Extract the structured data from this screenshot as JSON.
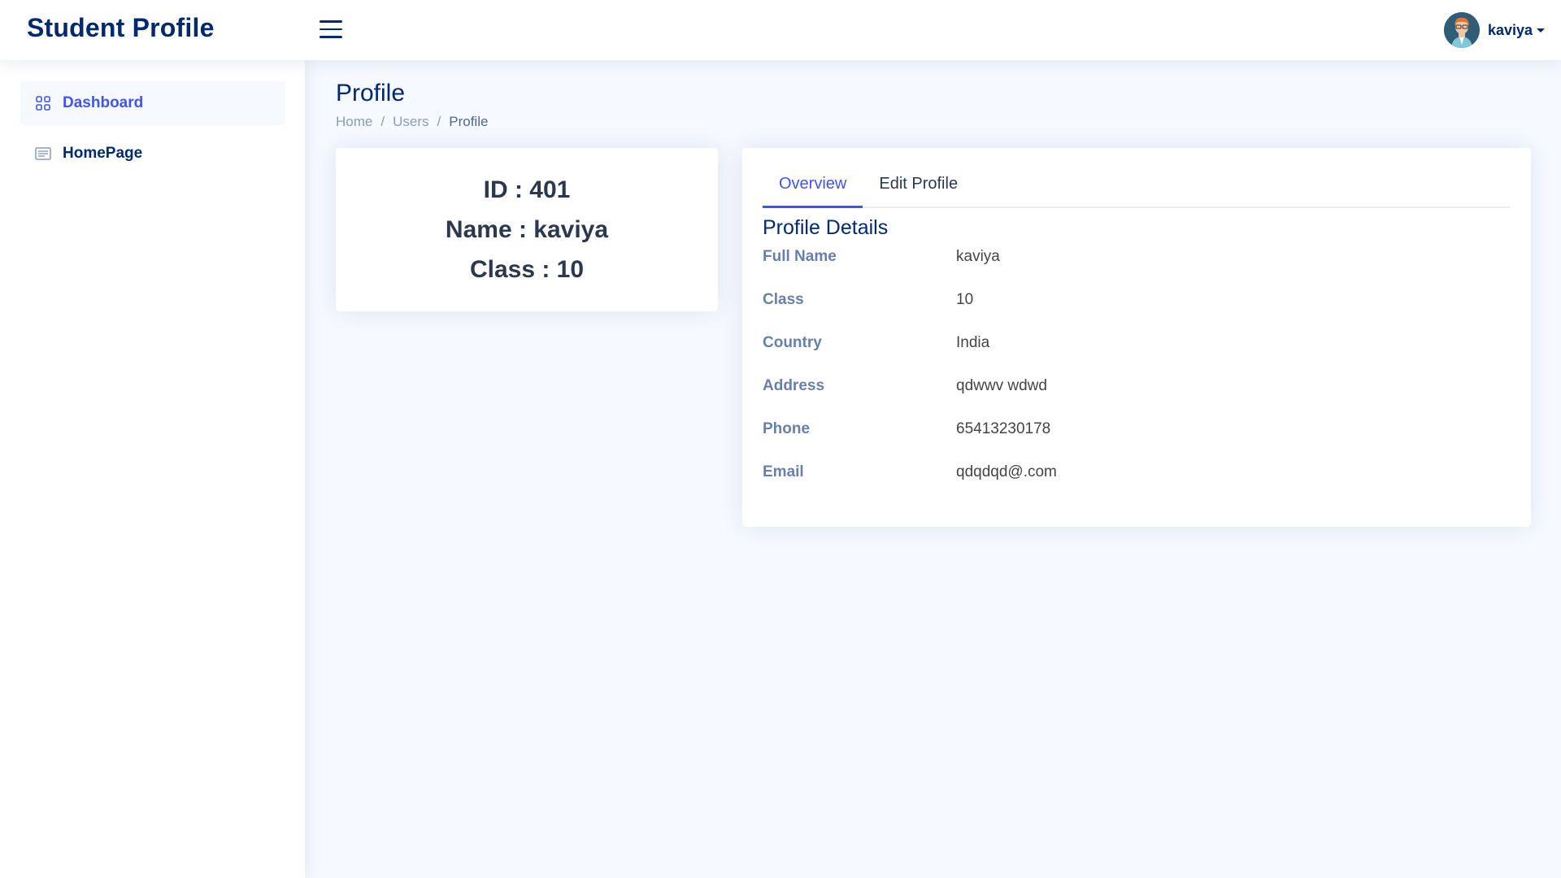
{
  "header": {
    "logo": "Student Profile",
    "user_name": "kaviya"
  },
  "sidebar": {
    "items": [
      {
        "label": "Dashboard",
        "icon": "grid-icon"
      },
      {
        "label": "HomePage",
        "icon": "layout-text-icon"
      }
    ]
  },
  "pagetitle": {
    "title": "Profile",
    "breadcrumb": [
      "Home",
      "Users",
      "Profile"
    ],
    "separator": "/"
  },
  "summary_card": {
    "id_line": "ID : 401",
    "name_line": "Name : kaviya",
    "class_line": "Class : 10"
  },
  "details_card": {
    "tabs": [
      "Overview",
      "Edit Profile"
    ],
    "section_title": "Profile Details",
    "rows": [
      {
        "label": "Full Name",
        "value": "kaviya"
      },
      {
        "label": "Class",
        "value": "10"
      },
      {
        "label": "Country",
        "value": "India"
      },
      {
        "label": "Address",
        "value": "qdwwv wdwd"
      },
      {
        "label": "Phone",
        "value": "65413230178"
      },
      {
        "label": "Email",
        "value": "qdqdqd@.com"
      }
    ]
  },
  "colors": {
    "brand": "#012970",
    "accent": "#4154f1",
    "background": "#f6f9ff"
  }
}
